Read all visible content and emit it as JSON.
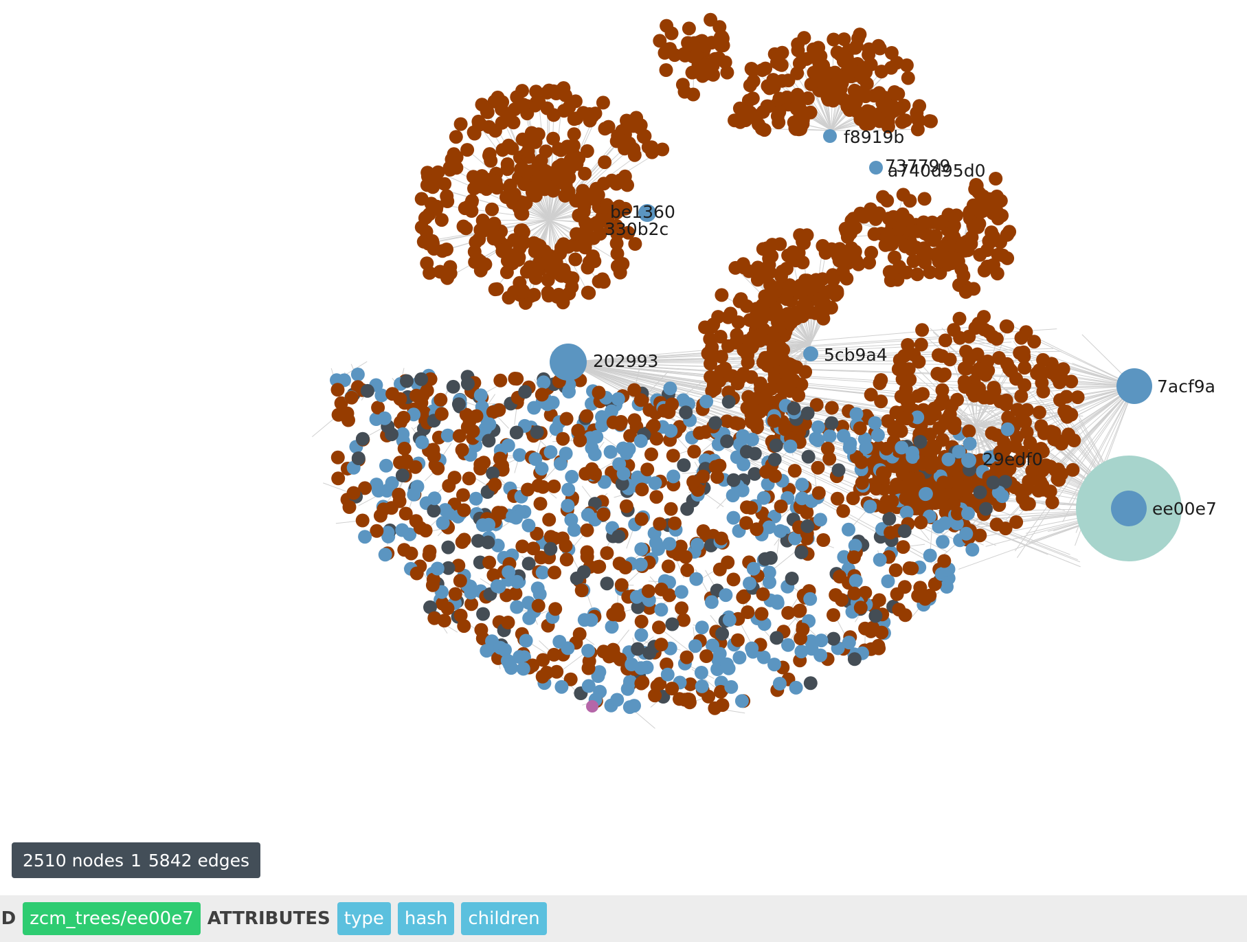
{
  "graph": {
    "colors": {
      "tree": "#5b95c1",
      "blob": "#963c00",
      "commit": "#444d55",
      "other": "#b566a8",
      "edge": "#cfcfcf",
      "highlight": "#a7d4cc"
    },
    "labels": [
      "be1360",
      "330b2c",
      "f8919b",
      "737799",
      "a740d95d0",
      "202993",
      "5cb9a4",
      "7acf9a",
      "29edf0",
      "ee00e7"
    ],
    "selected": "ee00e7"
  },
  "stats": {
    "nodes": "2510 nodes",
    "separator": "1",
    "edges": "5842 edges"
  },
  "selection": {
    "id_label": "ID",
    "id_value": "zcm_trees/ee00e7",
    "attributes_label": "ATTRIBUTES",
    "attributes": [
      "type",
      "hash",
      "children"
    ]
  }
}
